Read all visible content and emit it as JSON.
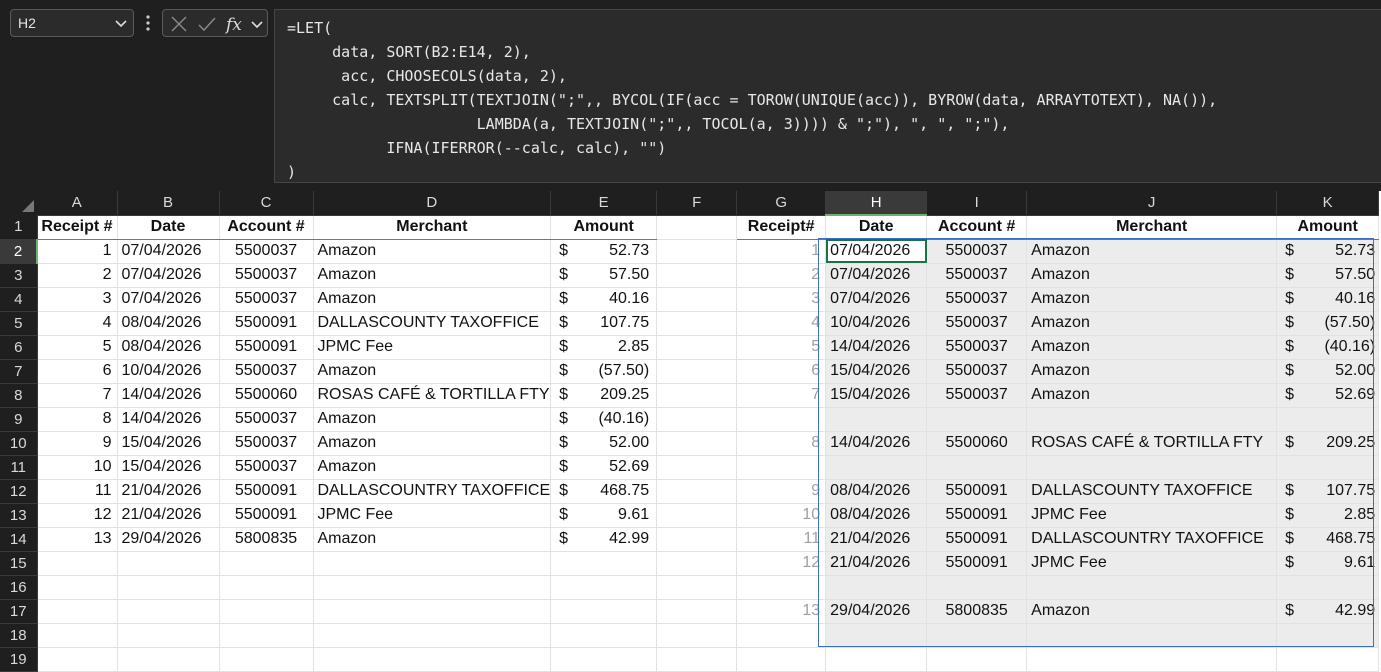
{
  "name_box": "H2",
  "formula_lines": [
    "=LET(",
    "     data, SORT(B2:E14, 2),",
    "      acc, CHOOSECOLS(data, 2),",
    "     calc, TEXTSPLIT(TEXTJOIN(\";\",, BYCOL(IF(acc = TOROW(UNIQUE(acc)), BYROW(data, ARRAYTOTEXT), NA()),",
    "                     LAMBDA(a, TEXTJOIN(\";\",, TOCOL(a, 3)))) & \";\"), \", \", \";\"),",
    "           IFNA(IFERROR(--calc, calc), \"\")",
    ")"
  ],
  "columns": [
    "A",
    "B",
    "C",
    "D",
    "E",
    "F",
    "G",
    "H",
    "I",
    "J",
    "K"
  ],
  "rows": [
    "1",
    "2",
    "3",
    "4",
    "5",
    "6",
    "7",
    "8",
    "9",
    "10",
    "11",
    "12",
    "13",
    "14",
    "15",
    "16",
    "17",
    "18",
    "19"
  ],
  "source_headers": {
    "receipt": "Receipt #",
    "date": "Date",
    "account": "Account #",
    "merchant": "Merchant",
    "amount": "Amount"
  },
  "result_headers": {
    "receipt": "Receipt#",
    "date": "Date",
    "account": "Account #",
    "merchant": "Merchant",
    "amount": "Amount"
  },
  "currency": "$",
  "source_rows": [
    {
      "receipt": "1",
      "date": "07/04/2026",
      "account": "5500037",
      "merchant": "Amazon",
      "amount": "52.73"
    },
    {
      "receipt": "2",
      "date": "07/04/2026",
      "account": "5500037",
      "merchant": "Amazon",
      "amount": "57.50"
    },
    {
      "receipt": "3",
      "date": "07/04/2026",
      "account": "5500037",
      "merchant": "Amazon",
      "amount": "40.16"
    },
    {
      "receipt": "4",
      "date": "08/04/2026",
      "account": "5500091",
      "merchant": "DALLASCOUNTY TAXOFFICE",
      "amount": "107.75"
    },
    {
      "receipt": "5",
      "date": "08/04/2026",
      "account": "5500091",
      "merchant": "JPMC Fee",
      "amount": "2.85"
    },
    {
      "receipt": "6",
      "date": "10/04/2026",
      "account": "5500037",
      "merchant": "Amazon",
      "amount": "(57.50)"
    },
    {
      "receipt": "7",
      "date": "14/04/2026",
      "account": "5500060",
      "merchant": "ROSAS CAFÉ & TORTILLA FTY",
      "amount": "209.25"
    },
    {
      "receipt": "8",
      "date": "14/04/2026",
      "account": "5500037",
      "merchant": "Amazon",
      "amount": "(40.16)"
    },
    {
      "receipt": "9",
      "date": "15/04/2026",
      "account": "5500037",
      "merchant": "Amazon",
      "amount": "52.00"
    },
    {
      "receipt": "10",
      "date": "15/04/2026",
      "account": "5500037",
      "merchant": "Amazon",
      "amount": "52.69"
    },
    {
      "receipt": "11",
      "date": "21/04/2026",
      "account": "5500091",
      "merchant": "DALLASCOUNTRY TAXOFFICE",
      "amount": "468.75"
    },
    {
      "receipt": "12",
      "date": "21/04/2026",
      "account": "5500091",
      "merchant": "JPMC Fee",
      "amount": "9.61"
    },
    {
      "receipt": "13",
      "date": "29/04/2026",
      "account": "5800835",
      "merchant": "Amazon",
      "amount": "42.99"
    }
  ],
  "result_rows": [
    {
      "receipt": "1",
      "date": "07/04/2026",
      "account": "5500037",
      "merchant": "Amazon",
      "amount": "52.73"
    },
    {
      "receipt": "2",
      "date": "07/04/2026",
      "account": "5500037",
      "merchant": "Amazon",
      "amount": "57.50"
    },
    {
      "receipt": "3",
      "date": "07/04/2026",
      "account": "5500037",
      "merchant": "Amazon",
      "amount": "40.16"
    },
    {
      "receipt": "4",
      "date": "10/04/2026",
      "account": "5500037",
      "merchant": "Amazon",
      "amount": "(57.50)"
    },
    {
      "receipt": "5",
      "date": "14/04/2026",
      "account": "5500037",
      "merchant": "Amazon",
      "amount": "(40.16)"
    },
    {
      "receipt": "6",
      "date": "15/04/2026",
      "account": "5500037",
      "merchant": "Amazon",
      "amount": "52.00"
    },
    {
      "receipt": "7",
      "date": "15/04/2026",
      "account": "5500037",
      "merchant": "Amazon",
      "amount": "52.69"
    },
    {
      "blank": true
    },
    {
      "receipt": "8",
      "date": "14/04/2026",
      "account": "5500060",
      "merchant": "ROSAS CAFÉ & TORTILLA FTY",
      "amount": "209.25"
    },
    {
      "blank": true
    },
    {
      "receipt": "9",
      "date": "08/04/2026",
      "account": "5500091",
      "merchant": "DALLASCOUNTY TAXOFFICE",
      "amount": "107.75"
    },
    {
      "receipt": "10",
      "date": "08/04/2026",
      "account": "5500091",
      "merchant": "JPMC Fee",
      "amount": "2.85"
    },
    {
      "receipt": "11",
      "date": "21/04/2026",
      "account": "5500091",
      "merchant": "DALLASCOUNTRY TAXOFFICE",
      "amount": "468.75"
    },
    {
      "receipt": "12",
      "date": "21/04/2026",
      "account": "5500091",
      "merchant": "JPMC Fee",
      "amount": "9.61"
    },
    {
      "blank": true
    },
    {
      "receipt": "13",
      "date": "29/04/2026",
      "account": "5800835",
      "merchant": "Amazon",
      "amount": "42.99"
    },
    {
      "blank": true
    }
  ],
  "colors": {
    "selection": "#1e7145",
    "spill_border": "#3b6fc4",
    "spill_fill": "#ececec",
    "header_bg": "#1f1f1f"
  },
  "icons": {
    "namebox": "chevron-down-icon",
    "cancel": "cancel-x-icon",
    "enter": "checkmark-icon",
    "function": "fx-icon",
    "expand": "chevron-down-icon"
  }
}
